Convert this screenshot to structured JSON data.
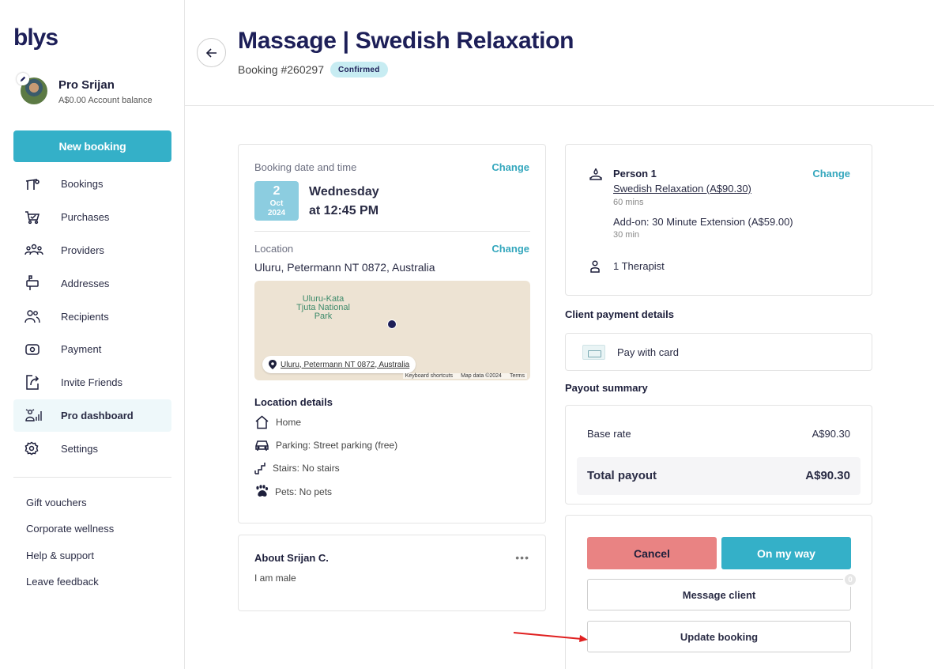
{
  "sidebar": {
    "logo": "blys",
    "profile": {
      "name": "Pro Srijan",
      "balance": "A$0.00 Account balance"
    },
    "new_booking_label": "New booking",
    "nav": [
      {
        "label": "Bookings",
        "icon": "bookings-icon"
      },
      {
        "label": "Purchases",
        "icon": "cart-icon"
      },
      {
        "label": "Providers",
        "icon": "providers-icon"
      },
      {
        "label": "Addresses",
        "icon": "mailbox-icon"
      },
      {
        "label": "Recipients",
        "icon": "recipients-icon"
      },
      {
        "label": "Payment",
        "icon": "payment-icon"
      },
      {
        "label": "Invite Friends",
        "icon": "share-icon"
      },
      {
        "label": "Pro dashboard",
        "icon": "pro-dashboard-icon",
        "active": true
      },
      {
        "label": "Settings",
        "icon": "gear-icon"
      }
    ],
    "links": [
      "Gift vouchers",
      "Corporate wellness",
      "Help & support",
      "Leave feedback"
    ]
  },
  "header": {
    "title": "Massage | Swedish Relaxation",
    "booking_id": "Booking #260297",
    "status": "Confirmed"
  },
  "booking": {
    "date_label": "Booking date and time",
    "change_label": "Change",
    "day": "2",
    "month": "Oct",
    "year": "2024",
    "weekday": "Wednesday",
    "time": "at 12:45 PM",
    "location_label": "Location",
    "address": "Uluru, Petermann NT 0872, Australia",
    "map": {
      "park_label": "Uluru-Kata Tjuta National Park",
      "chip": "Uluru, Petermann NT 0872, Australia",
      "footer": [
        "Keyboard shortcuts",
        "Map data ©2024",
        "Terms"
      ]
    },
    "location_details_label": "Location details",
    "location_details": [
      {
        "icon": "home-icon",
        "text": "Home"
      },
      {
        "icon": "car-icon",
        "text": "Parking: Street parking (free)"
      },
      {
        "icon": "stairs-icon",
        "text": "Stairs: No stairs"
      },
      {
        "icon": "paw-icon",
        "text": "Pets: No pets"
      }
    ]
  },
  "about": {
    "title": "About Srijan C.",
    "text": "I am male",
    "more": "•••"
  },
  "person": {
    "name": "Person 1",
    "change_label": "Change",
    "service": "Swedish Relaxation (A$90.30)",
    "duration": "60 mins",
    "addon": "Add-on: 30 Minute Extension (A$59.00)",
    "addon_duration": "30 min",
    "therapists": "1 Therapist"
  },
  "payment": {
    "title": "Client payment details",
    "method": "Pay with card"
  },
  "payout": {
    "title": "Payout summary",
    "base_label": "Base rate",
    "base_value": "A$90.30",
    "total_label": "Total payout",
    "total_value": "A$90.30"
  },
  "actions": {
    "cancel": "Cancel",
    "on_my_way": "On my way",
    "message": "Message client",
    "message_count": "0",
    "update": "Update booking"
  },
  "colors": {
    "accent": "#34b0c8",
    "brand": "#1d1f58",
    "cancel": "#e98383",
    "annotation_arrow": "#e02020"
  }
}
